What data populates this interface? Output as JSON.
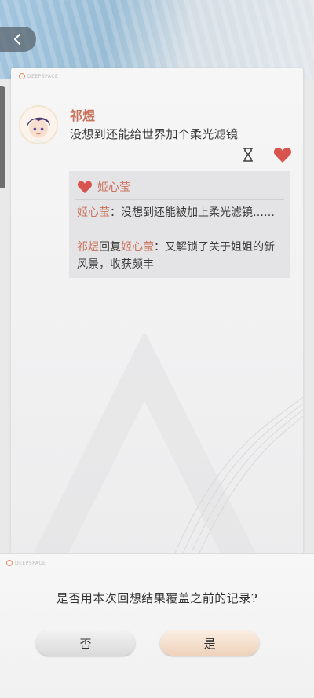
{
  "post": {
    "author": "祁煜",
    "text": "没想到还能给世界加个柔光滤镜",
    "liked": true
  },
  "comments": {
    "liker": "姬心莹",
    "items": [
      {
        "author": "姬心莹",
        "reply_to": "",
        "text": "：没想到还能被加上柔光滤镜……"
      },
      {
        "author": "祁煜",
        "reply_word": "回复",
        "reply_to": "姬心莹",
        "text": "：又解锁了关于姐姐的新风景，收获颇丰"
      }
    ]
  },
  "dialog": {
    "question": "是否用本次回想结果覆盖之前的记录?",
    "no_label": "否",
    "yes_label": "是"
  },
  "icons": {
    "back": "chevron-left-icon",
    "like": "heart-icon",
    "timer": "hourglass-icon"
  },
  "colors": {
    "accent": "#c9715b",
    "heart": "#d9534f"
  }
}
